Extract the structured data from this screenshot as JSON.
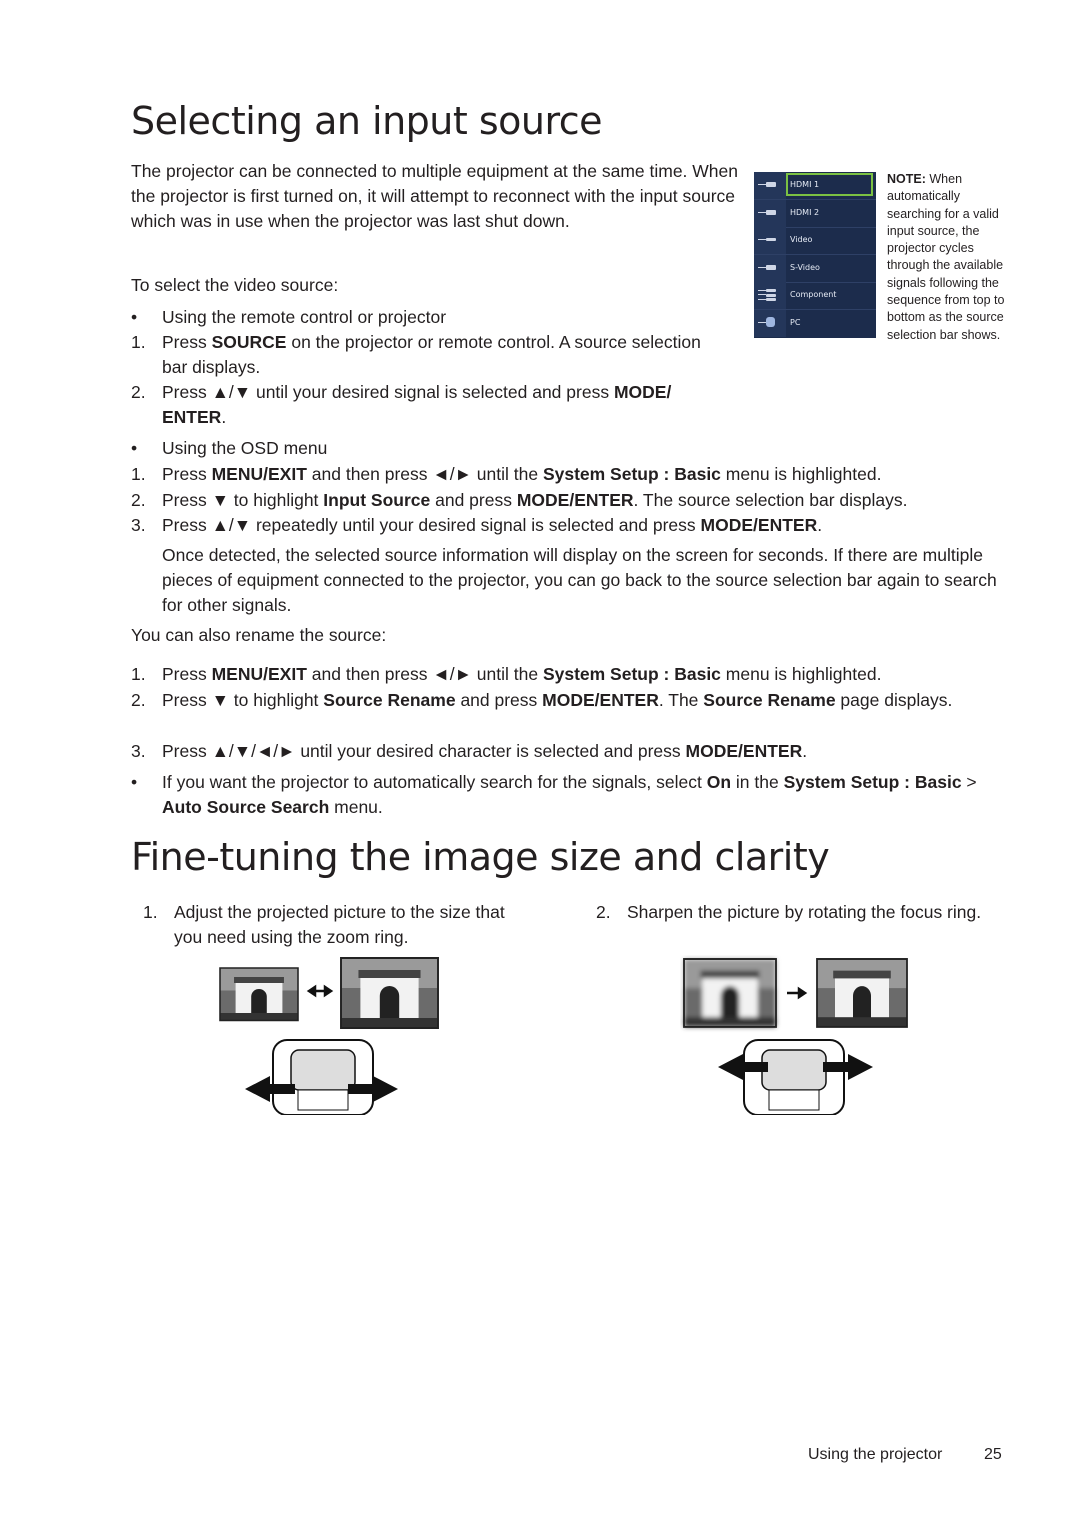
{
  "section1": {
    "title": "Selecting an input source",
    "intro": "The projector can be connected to multiple equipment at the same time. When the projector is first turned on, it will attempt to reconnect with the input source which was in use when the projector was last shut down.",
    "to_select": "To select the video source:",
    "method1_label": "Using the remote control or projector",
    "method1_steps": [
      {
        "num": "1.",
        "pre": "Press ",
        "bold": "SOURCE",
        "post": " on the projector or remote control. A source selection bar displays."
      },
      {
        "num": "2.",
        "pre": "Press ▲/▼ until your desired signal is selected and press ",
        "bold": "MODE/ ENTER",
        "post": "."
      }
    ],
    "method2_label": "Using the OSD menu",
    "osd_step1": {
      "num": "1.",
      "a": "Press ",
      "b1": "MENU/EXIT",
      "c": " and then press ◄/► until the ",
      "b2": "System Setup : Basic",
      "d": " menu is highlighted."
    },
    "osd_step2": {
      "num": "2.",
      "a": "Press ▼ to highlight ",
      "b1": "Input Source",
      "c": " and press ",
      "b2": "MODE/ENTER",
      "d": ". The source selection bar displays."
    },
    "osd_step3": {
      "num": "3.",
      "a": "Press ▲/▼ repeatedly until your desired signal is selected and press ",
      "b1": "MODE/ENTER",
      "c": "."
    },
    "once_detected": "Once detected, the selected source information will display on the screen for seconds. If there are multiple pieces of equipment connected to the projector, you can go back to the source selection bar again to search for other signals.",
    "rename_intro": "You can also rename the source:",
    "rename_step1": {
      "num": "1.",
      "a": "Press ",
      "b1": "MENU/EXIT",
      "c": " and then press ◄/► until the ",
      "b2": "System Setup : Basic",
      "d": " menu is highlighted."
    },
    "rename_step2": {
      "num": "2.",
      "a": "Press ▼ to highlight ",
      "b1": "Source Rename",
      "c": " and press ",
      "b2": "MODE/ENTER",
      "d": ". The ",
      "b3": "Source Rename",
      "e": " page displays."
    },
    "rename_step3": {
      "num": "3.",
      "a": "Press ▲/▼/◄/► until your desired character is selected and press ",
      "b1": "MODE/ENTER",
      "c": "."
    },
    "auto_search": {
      "a": "If you want the projector to automatically search for the signals, select ",
      "b1": "On",
      "c": " in the ",
      "b2": "System Setup : Basic",
      "d": " > ",
      "b3": "Auto Source Search",
      "e": " menu."
    },
    "source_bar": {
      "items": [
        {
          "label": "HDMI 1",
          "icon": "hdmi-connector-icon",
          "selected": true
        },
        {
          "label": "HDMI 2",
          "icon": "hdmi-connector-icon",
          "selected": false
        },
        {
          "label": "Video",
          "icon": "rca-connector-icon",
          "selected": false
        },
        {
          "label": "S-Video",
          "icon": "svideo-connector-icon",
          "selected": false
        },
        {
          "label": "Component",
          "icon": "component-connector-icon",
          "selected": false
        },
        {
          "label": "PC",
          "icon": "vga-connector-icon",
          "selected": false
        }
      ],
      "highlight_color": "#7bc143",
      "background_color": "#1c2c4c"
    },
    "note": {
      "label": "NOTE:",
      "text": " When automatically searching for a valid input source, the projector cycles through the available signals following the sequence from top to bottom as the source selection bar shows."
    }
  },
  "section2": {
    "title": "Fine-tuning the image size and clarity",
    "step1": {
      "num": "1.",
      "text": "Adjust the projected picture to the size that you need using the zoom ring."
    },
    "step2": {
      "num": "2.",
      "text": "Sharpen the picture by rotating the focus ring."
    }
  },
  "footer": {
    "section": "Using the projector",
    "page": "25"
  },
  "bullet": "•"
}
